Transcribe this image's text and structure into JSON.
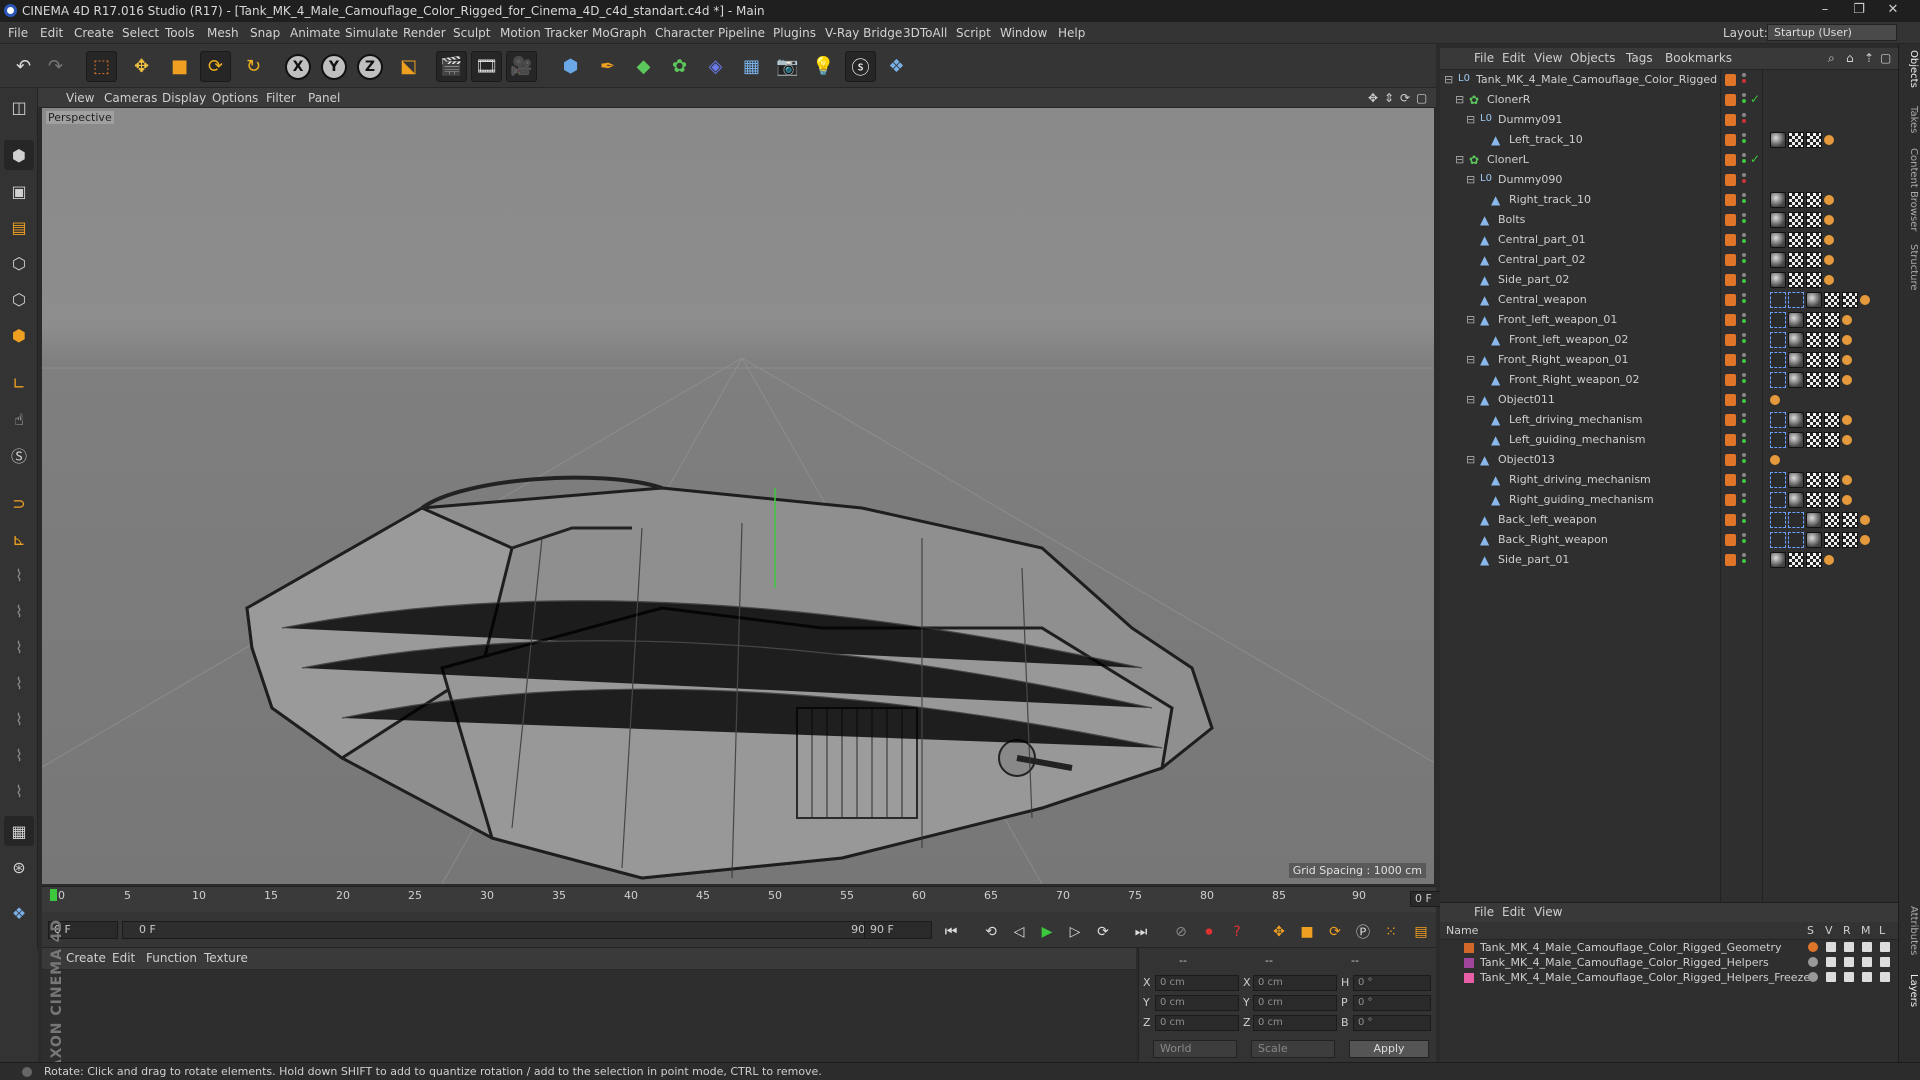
{
  "window": {
    "title": "CINEMA 4D R17.016 Studio (R17) - [Tank_MK_4_Male_Camouflage_Color_Rigged_for_Cinema_4D_c4d_standart.c4d *] - Main",
    "controls": [
      "–",
      "❐",
      "✕"
    ]
  },
  "menu": [
    "File",
    "Edit",
    "Create",
    "Select",
    "Tools",
    "Mesh",
    "Snap",
    "Animate",
    "Simulate",
    "Render",
    "Sculpt",
    "Motion Tracker",
    "MoGraph",
    "Character",
    "Pipeline",
    "Plugins",
    "V-Ray Bridge",
    "3DToAll",
    "Script",
    "Window",
    "Help"
  ],
  "layout": {
    "label": "Layout:",
    "value": "Startup (User)"
  },
  "viewport": {
    "menu": [
      "View",
      "Cameras",
      "Display",
      "Options",
      "Filter",
      "Panel"
    ],
    "label": "Perspective",
    "grid_spacing": "Grid Spacing : 1000 cm"
  },
  "timeline": {
    "ticks": [
      "0",
      "5",
      "10",
      "15",
      "20",
      "25",
      "30",
      "35",
      "40",
      "45",
      "50",
      "55",
      "60",
      "65",
      "70",
      "75",
      "80",
      "85",
      "90"
    ],
    "current": "0 F"
  },
  "transport": {
    "start": "0 F",
    "range_start": "0 F",
    "range_end": "90 F",
    "end": "90 F"
  },
  "material": {
    "menu": [
      "Create",
      "Edit",
      "Function",
      "Texture"
    ]
  },
  "coords": {
    "pos_labels": [
      "X",
      "Y",
      "Z"
    ],
    "pos_values": [
      "0 cm",
      "0 cm",
      "0 cm"
    ],
    "size_labels": [
      "X",
      "Y",
      "Z"
    ],
    "size_values": [
      "0 cm",
      "0 cm",
      "0 cm"
    ],
    "rot_labels": [
      "H",
      "P",
      "B"
    ],
    "rot_values": [
      "0 °",
      "0 °",
      "0 °"
    ],
    "world": "World",
    "scale": "Scale",
    "apply": "Apply",
    "dash1": "--",
    "dash2": "--",
    "dash3": "--"
  },
  "objects_menu": [
    "File",
    "Edit",
    "View",
    "Objects",
    "Tags",
    "Bookmarks"
  ],
  "objects": [
    {
      "name": "Tank_MK_4_Male_Camouflage_Color_Rigged",
      "indent": 0,
      "icon": "null",
      "tags": []
    },
    {
      "name": "ClonerR",
      "indent": 1,
      "icon": "cloner",
      "tags": [
        "check"
      ]
    },
    {
      "name": "Dummy091",
      "indent": 2,
      "icon": "null",
      "tags": []
    },
    {
      "name": "Left_track_10",
      "indent": 3,
      "icon": "mesh",
      "tags": [
        "sph",
        "chk",
        "chk",
        "dot"
      ]
    },
    {
      "name": "ClonerL",
      "indent": 1,
      "icon": "cloner",
      "tags": [
        "check"
      ]
    },
    {
      "name": "Dummy090",
      "indent": 2,
      "icon": "null",
      "tags": []
    },
    {
      "name": "Right_track_10",
      "indent": 3,
      "icon": "mesh",
      "tags": [
        "sph",
        "chk",
        "chk",
        "dot"
      ]
    },
    {
      "name": "Bolts",
      "indent": 2,
      "icon": "mesh",
      "tags": [
        "sph",
        "chk",
        "chk",
        "dot"
      ]
    },
    {
      "name": "Central_part_01",
      "indent": 2,
      "icon": "mesh",
      "tags": [
        "sph",
        "chk",
        "chk",
        "dot"
      ]
    },
    {
      "name": "Central_part_02",
      "indent": 2,
      "icon": "mesh",
      "tags": [
        "sph",
        "chk",
        "chk",
        "dot"
      ]
    },
    {
      "name": "Side_part_02",
      "indent": 2,
      "icon": "mesh",
      "tags": [
        "sph",
        "chk",
        "chk",
        "dot"
      ]
    },
    {
      "name": "Central_weapon",
      "indent": 2,
      "icon": "mesh",
      "tags": [
        "ph",
        "ph",
        "sph",
        "chk",
        "chk",
        "dot"
      ]
    },
    {
      "name": "Front_left_weapon_01",
      "indent": 2,
      "icon": "mesh",
      "tags": [
        "ph",
        "sph",
        "chk",
        "chk",
        "dot"
      ]
    },
    {
      "name": "Front_left_weapon_02",
      "indent": 3,
      "icon": "mesh",
      "tags": [
        "ph",
        "sph",
        "chk",
        "chk",
        "dot"
      ]
    },
    {
      "name": "Front_Right_weapon_01",
      "indent": 2,
      "icon": "mesh",
      "tags": [
        "ph",
        "sph",
        "chk",
        "chk",
        "dot"
      ]
    },
    {
      "name": "Front_Right_weapon_02",
      "indent": 3,
      "icon": "mesh",
      "tags": [
        "ph",
        "sph",
        "chk",
        "chk",
        "dot"
      ]
    },
    {
      "name": "Object011",
      "indent": 2,
      "icon": "mesh",
      "tags": [
        "dot"
      ]
    },
    {
      "name": "Left_driving_mechanism",
      "indent": 3,
      "icon": "mesh",
      "tags": [
        "ph",
        "sph",
        "chk",
        "chk",
        "dot"
      ]
    },
    {
      "name": "Left_guiding_mechanism",
      "indent": 3,
      "icon": "mesh",
      "tags": [
        "ph",
        "sph",
        "chk",
        "chk",
        "dot"
      ]
    },
    {
      "name": "Object013",
      "indent": 2,
      "icon": "mesh",
      "tags": [
        "dot"
      ]
    },
    {
      "name": "Right_driving_mechanism",
      "indent": 3,
      "icon": "mesh",
      "tags": [
        "ph",
        "sph",
        "chk",
        "chk",
        "dot"
      ]
    },
    {
      "name": "Right_guiding_mechanism",
      "indent": 3,
      "icon": "mesh",
      "tags": [
        "ph",
        "sph",
        "chk",
        "chk",
        "dot"
      ]
    },
    {
      "name": "Back_left_weapon",
      "indent": 2,
      "icon": "mesh",
      "tags": [
        "ph",
        "ph",
        "sph",
        "chk",
        "chk",
        "dot"
      ]
    },
    {
      "name": "Back_Right_weapon",
      "indent": 2,
      "icon": "mesh",
      "tags": [
        "ph",
        "ph",
        "sph",
        "chk",
        "chk",
        "dot"
      ]
    },
    {
      "name": "Side_part_01",
      "indent": 2,
      "icon": "mesh",
      "tags": [
        "sph",
        "chk",
        "chk",
        "dot"
      ]
    }
  ],
  "layers_menu": [
    "File",
    "Edit",
    "View"
  ],
  "layers_header": {
    "name": "Name",
    "cols": [
      "S",
      "V",
      "R",
      "M",
      "L"
    ]
  },
  "layers": [
    {
      "name": "Tank_MK_4_Male_Camouflage_Color_Rigged_Geometry",
      "color": "#d2672a"
    },
    {
      "name": "Tank_MK_4_Male_Camouflage_Color_Rigged_Helpers",
      "color": "#a0449c"
    },
    {
      "name": "Tank_MK_4_Male_Camouflage_Color_Rigged_Helpers_Freeze",
      "color": "#e85fa8"
    }
  ],
  "right_tabs": [
    "Objects",
    "Takes",
    "Content Browser",
    "Structure"
  ],
  "right_tabs_lower": [
    "Attributes",
    "Layers"
  ],
  "maxon": "MAXON CINEMA 4D",
  "status": "Rotate: Click and drag to rotate elements. Hold down SHIFT to add to quantize rotation / add to the selection in point mode, CTRL to remove.",
  "colors": {
    "accent": "#e0752a",
    "blue": "#3e7bd6"
  }
}
